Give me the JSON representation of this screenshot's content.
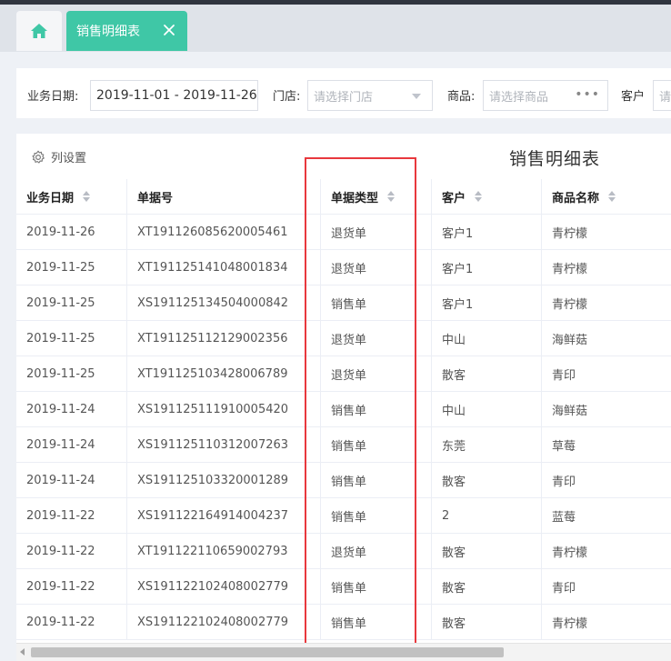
{
  "tabs": {
    "home_icon": "home-icon",
    "active_label": "销售明细表",
    "close_icon": "close-icon"
  },
  "filters": {
    "date_label": "业务日期:",
    "date_value": "2019-11-01 - 2019-11-26",
    "store_label": "门店:",
    "store_placeholder": "请选择门店",
    "product_label": "商品:",
    "product_placeholder": "请选择商品",
    "customer_label": "客户",
    "customer_placeholder": "请"
  },
  "panel": {
    "column_settings_label": "列设置",
    "title": "销售明细表"
  },
  "table": {
    "headers": [
      "业务日期",
      "单据号",
      "单据类型",
      "客户",
      "商品名称"
    ],
    "rows": [
      [
        "2019-11-26",
        "XT191126085620005461",
        "退货单",
        "客户1",
        "青柠檬"
      ],
      [
        "2019-11-25",
        "XT191125141048001834",
        "退货单",
        "客户1",
        "青柠檬"
      ],
      [
        "2019-11-25",
        "XS191125134504000842",
        "销售单",
        "客户1",
        "青柠檬"
      ],
      [
        "2019-11-25",
        "XT191125112129002356",
        "退货单",
        "中山",
        "海鲜菇"
      ],
      [
        "2019-11-25",
        "XT191125103428006789",
        "退货单",
        "散客",
        "青印"
      ],
      [
        "2019-11-24",
        "XS191125111910005420",
        "销售单",
        "中山",
        "海鲜菇"
      ],
      [
        "2019-11-24",
        "XS191125110312007263",
        "销售单",
        "东莞",
        "草莓"
      ],
      [
        "2019-11-24",
        "XS191125103320001289",
        "销售单",
        "散客",
        "青印"
      ],
      [
        "2019-11-22",
        "XS191122164914004237",
        "销售单",
        "2",
        "蓝莓"
      ],
      [
        "2019-11-22",
        "XT191122110659002793",
        "退货单",
        "散客",
        "青柠檬"
      ],
      [
        "2019-11-22",
        "XS191122102408002779",
        "销售单",
        "散客",
        "青印"
      ],
      [
        "2019-11-22",
        "XS191122102408002779",
        "销售单",
        "散客",
        "青柠檬"
      ]
    ]
  },
  "colors": {
    "accent": "#3fc7a6",
    "highlight_border": "#e8383d",
    "topbar": "#30353f"
  }
}
